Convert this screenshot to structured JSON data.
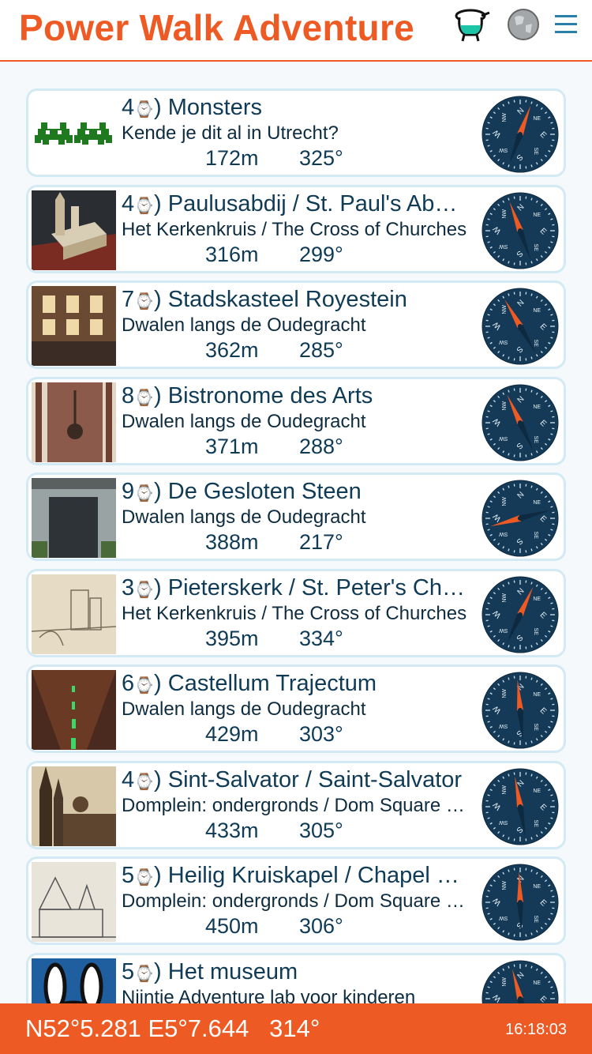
{
  "header": {
    "title": "Power Walk Adventure",
    "icons": [
      "potion-icon",
      "globe-icon",
      "menu-icon"
    ]
  },
  "colors": {
    "accent": "#ee5a24",
    "text": "#0f3b57",
    "card_border": "#d3eaf4",
    "compass_face": "#143a57",
    "needle": "#ee5a24"
  },
  "walk_symbol": "⌚",
  "items": [
    {
      "num": "4",
      "title": "Monsters",
      "subtitle": "Kende je dit al in Utrecht?",
      "distance": "172m",
      "bearing": "325°",
      "thumb": "space-invaders"
    },
    {
      "num": "4",
      "title": "Paulusabdij / St. Paul's Abbey",
      "subtitle": "Het Kerkenkruis / The Cross of Churches",
      "distance": "316m",
      "bearing": "299°",
      "thumb": "abbey-model"
    },
    {
      "num": "7",
      "title": "Stadskasteel Royestein",
      "subtitle": "Dwalen langs de Oudegracht",
      "distance": "362m",
      "bearing": "285°",
      "thumb": "castle"
    },
    {
      "num": "8",
      "title": "Bistronome des Arts",
      "subtitle": "Dwalen langs de Oudegracht",
      "distance": "371m",
      "bearing": "288°",
      "thumb": "bistro"
    },
    {
      "num": "9",
      "title": "De Gesloten Steen",
      "subtitle": "Dwalen langs de Oudegracht",
      "distance": "388m",
      "bearing": "217°",
      "thumb": "door"
    },
    {
      "num": "3",
      "title": "Pieterskerk / St. Peter's Church",
      "subtitle": "Het Kerkenkruis / The Cross of Churches",
      "distance": "395m",
      "bearing": "334°",
      "thumb": "sketch"
    },
    {
      "num": "6",
      "title": "Castellum Trajectum",
      "subtitle": "Dwalen langs de Oudegracht",
      "distance": "429m",
      "bearing": "303°",
      "thumb": "tunnel"
    },
    {
      "num": "4",
      "title": "Sint-Salvator / Saint-Salvator",
      "subtitle": "Domplein: ondergronds / Dom Square underground",
      "distance": "433m",
      "bearing": "305°",
      "thumb": "cathedral"
    },
    {
      "num": "5",
      "title": "Heilig Kruiskapel / Chapel of the Holy Cross",
      "subtitle": "Domplein: ondergronds / Dom Square underground",
      "distance": "450m",
      "bearing": "306°",
      "thumb": "chapel-sketch"
    },
    {
      "num": "5",
      "title": "Het museum",
      "subtitle": "Nijntje Adventure lab voor kinderen",
      "distance": "",
      "bearing": "",
      "thumb": "bunny"
    }
  ],
  "compass_needle_angles": [
    20,
    340,
    330,
    335,
    255,
    25,
    355,
    350,
    358,
    345
  ],
  "footer": {
    "coords": "N52°5.281 E5°7.644   314°",
    "time": "16:18:03"
  }
}
